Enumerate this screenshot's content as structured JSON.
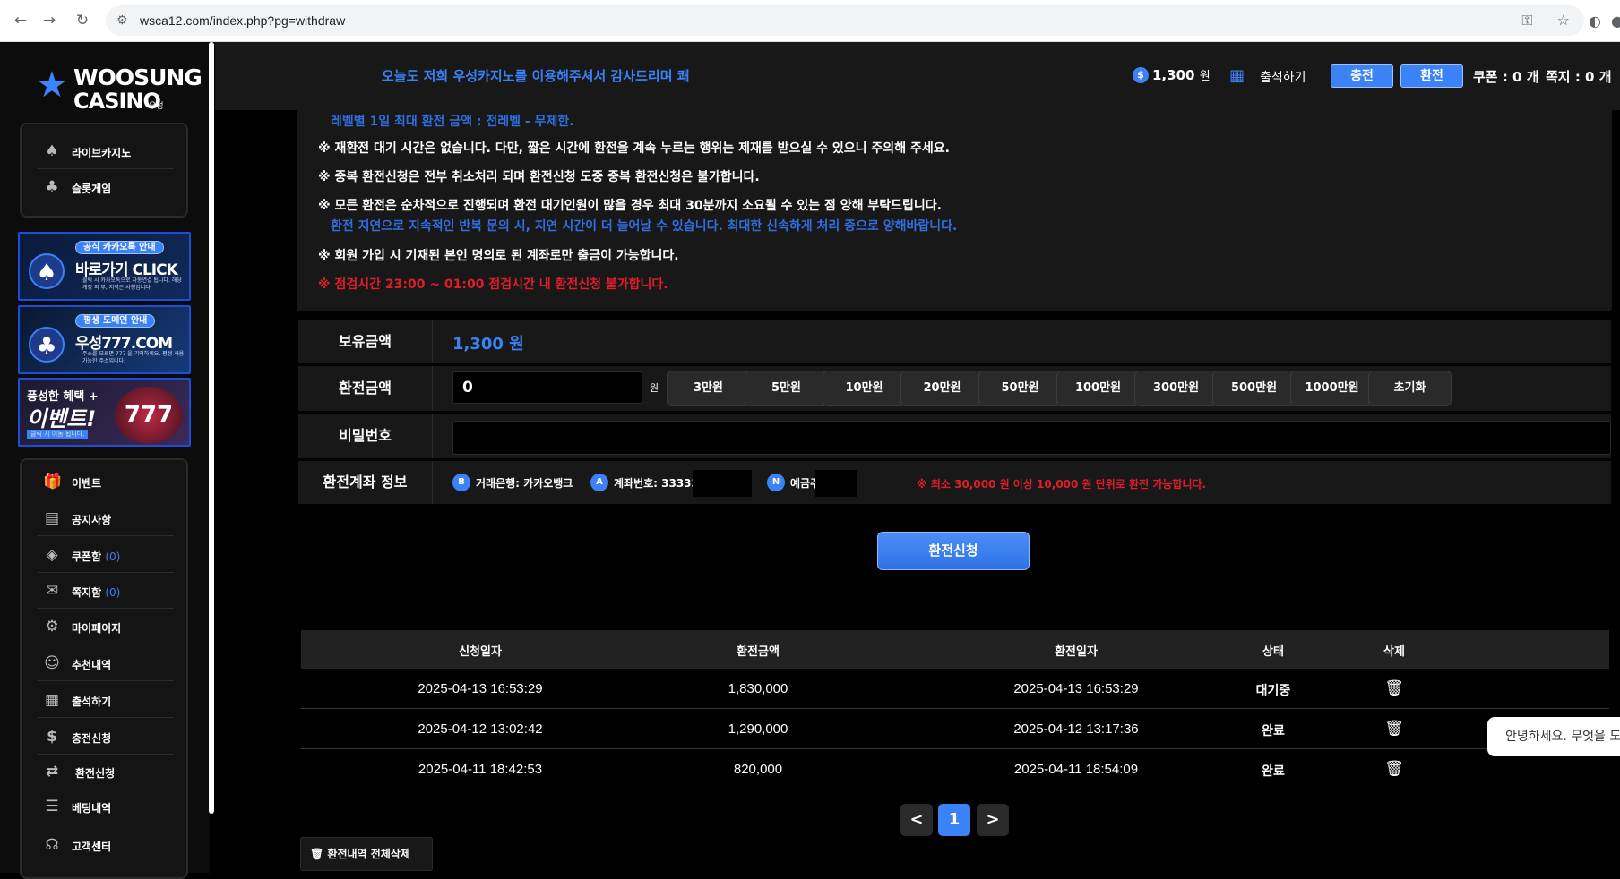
{
  "browser": {
    "url": "wsca12.com/index.php?pg=withdraw"
  },
  "logo": {
    "line1": "WOOSUNG",
    "line2": "CASINO",
    "sub": "우성"
  },
  "sidebar": {
    "games": [
      {
        "label": "라이브카지노",
        "icon": "spade-icon"
      },
      {
        "label": "슬롯게임",
        "icon": "club-icon"
      }
    ],
    "banners": [
      {
        "pill": "공식 카카오톡 안내",
        "big": "바로가기 CLICK",
        "small": "클릭 시 카카오톡으로 자동연결 됩니다. 해당 계정 외 부, 저녁은 사칭입니다."
      },
      {
        "pill": "평생 도메인 안내",
        "big": "우성777.COM",
        "small": "주소를 모르면 777 을 기억하세요. 평생 사용 가능한 주소입니다."
      },
      {
        "t1": "풍성한 혜택 +",
        "t2": "이벤트!",
        "t3": "클릭 시 이동 됩니다.",
        "slot": "777"
      }
    ],
    "menu": [
      {
        "label": "이벤트",
        "icon": "gift-icon"
      },
      {
        "label": "공지사항",
        "icon": "notice-icon"
      },
      {
        "label": "쿠폰함",
        "count": "(0)",
        "icon": "ticket-icon"
      },
      {
        "label": "쪽지함",
        "count": "(0)",
        "icon": "mail-icon"
      },
      {
        "label": "마이페이지",
        "icon": "user-gear-icon"
      },
      {
        "label": "추천내역",
        "icon": "users-icon"
      },
      {
        "label": "출석하기",
        "icon": "calendar-icon"
      },
      {
        "label": "충전신청",
        "icon": "deposit-icon"
      },
      {
        "label": "환전신청",
        "icon": "withdraw-icon"
      },
      {
        "label": "베팅내역",
        "icon": "list-icon"
      },
      {
        "label": "고객센터",
        "icon": "headset-icon"
      }
    ]
  },
  "topbar": {
    "marquee": "오늘도 저희 우성카지노를 이용해주셔서 감사드리며 쾌",
    "coin": "$",
    "balance": "1,300",
    "balance_unit": "원",
    "attend": "출석하기",
    "charge": "충전",
    "withdraw": "환전",
    "coupon": "쿠폰 : 0 개",
    "message": "쪽지 : 0 개"
  },
  "notice": {
    "level_line": "레벨별 1일 최대 환전 금액 : 전레벨 - 무제한.",
    "l1": "※ 재환전 대기 시간은 없습니다. 다만, 짧은 시간에 환전을 계속 누르는 행위는 제재를 받으실 수 있으니 주의해 주세요.",
    "l2": "※ 중복 환전신청은 전부 취소처리 되며 환전신청 도중 중복 환전신청은 불가합니다.",
    "l3": "※ 모든 환전은 순차적으로 진행되며 환전 대기인원이 많을 경우 최대 30분까지 소요될 수 있는 점 양해 부탁드립니다.",
    "l3_blue": "환전 지연으로 지속적인 반복 문의 시, 지연 시간이 더 늘어날 수 있습니다. 최대한 신속하게 처리 중으로 양해바랍니다.",
    "l4": "※ 회원 가입 시 기재된 본인 명의로 된 계좌로만 출금이 가능합니다.",
    "l5_red": "※ 점검시간 23:00 ~ 01:00 점검시간 내 환전신청 불가합니다."
  },
  "form": {
    "balance_label": "보유금액",
    "balance_value": "1,300 원",
    "amount_label": "환전금액",
    "amount_value": "0",
    "won": "원",
    "quick": [
      "3만원",
      "5만원",
      "10만원",
      "20만원",
      "50만원",
      "100만원",
      "300만원",
      "500만원",
      "1000만원",
      "초기화"
    ],
    "password_label": "비밀번호",
    "account_label": "환전계좌 정보",
    "bank_badge": "B",
    "bank": "거래은행: 카카오뱅크",
    "account_badge": "A",
    "account": "계좌번호: 33333",
    "holder_badge": "N",
    "holder": "예금주",
    "warning": "※ 최소 30,000 원 이상 10,000 원 단위로 환전 가능합니다."
  },
  "submit_label": "환전신청",
  "table": {
    "headers": [
      "신청일자",
      "환전금액",
      "환전일자",
      "상태",
      "삭제"
    ],
    "rows": [
      {
        "requested": "2025-04-13 16:53:29",
        "amount": "1,830,000",
        "processed": "2025-04-13 16:53:29",
        "status": "대기중"
      },
      {
        "requested": "2025-04-12 13:02:42",
        "amount": "1,290,000",
        "processed": "2025-04-12 13:17:36",
        "status": "완료"
      },
      {
        "requested": "2025-04-11 18:42:53",
        "amount": "820,000",
        "processed": "2025-04-11 18:54:09",
        "status": "완료"
      }
    ]
  },
  "pager": {
    "prev": "<",
    "current": "1",
    "next": ">"
  },
  "delete_all": "환전내역 전체삭제",
  "chat_bubble": "안녕하세요. 무엇을 도"
}
